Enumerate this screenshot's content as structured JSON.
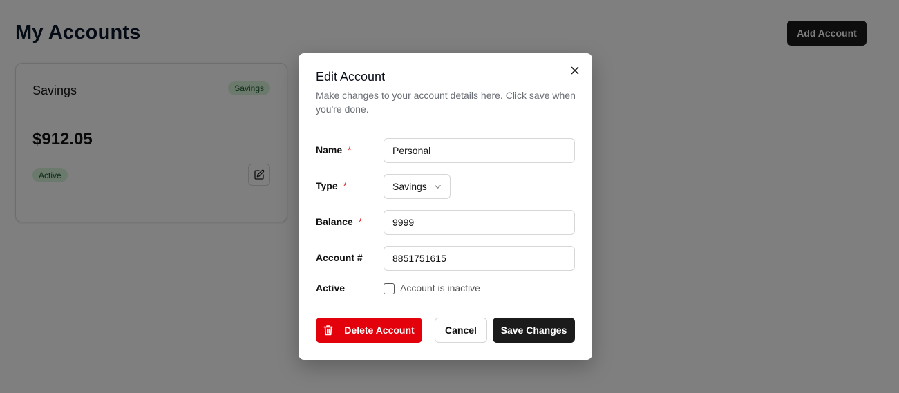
{
  "page": {
    "title": "My Accounts",
    "add_button_label": "Add Account"
  },
  "account_card": {
    "name": "Savings",
    "type_badge": "Savings",
    "balance": "$912.05",
    "status_badge": "Active"
  },
  "modal": {
    "title": "Edit Account",
    "description": "Make changes to your account details here. Click save when you're done.",
    "fields": {
      "name": {
        "label": "Name",
        "required_mark": "*",
        "value": "Personal"
      },
      "type": {
        "label": "Type",
        "required_mark": "*",
        "value": "Savings"
      },
      "balance": {
        "label": "Balance",
        "required_mark": "*",
        "value": "9999"
      },
      "account_number": {
        "label": "Account #",
        "value": "8851751615"
      },
      "active": {
        "label": "Active",
        "checkbox_label": "Account is inactive",
        "checked": false
      }
    },
    "buttons": {
      "delete": "Delete Account",
      "cancel": "Cancel",
      "save": "Save Changes"
    }
  },
  "colors": {
    "primary_dark": "#1b1b1b",
    "danger": "#e3020b",
    "badge_green_bg": "#d8f5dd",
    "badge_green_text": "#1c5a2b",
    "required": "#e1252b"
  },
  "icons": {
    "close": "close-icon",
    "edit": "edit-icon",
    "chevron": "chevron-down-icon",
    "trash": "trash-icon"
  }
}
